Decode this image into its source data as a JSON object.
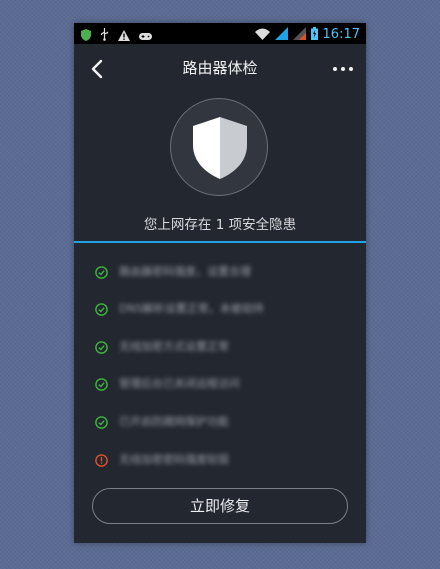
{
  "status_bar": {
    "time": "16:17",
    "icons": [
      "shield-app-icon",
      "usb-icon",
      "warning-icon",
      "game-controller-icon",
      "wifi-icon",
      "signal-icon",
      "signal-roaming-icon",
      "battery-icon"
    ]
  },
  "header": {
    "title": "路由器体检",
    "back_icon": "chevron-left-icon",
    "menu_icon": "more-horizontal-icon"
  },
  "summary": {
    "text": "您上网存在 1 项安全隐患"
  },
  "check_items": [
    {
      "status": "ok",
      "text": "路由器密码强度，设置合理"
    },
    {
      "status": "ok",
      "text": "DNS解析设置正常，未被劫持"
    },
    {
      "status": "ok",
      "text": "无线加密方式设置正常"
    },
    {
      "status": "ok",
      "text": "管理后台已关闭远程访问"
    },
    {
      "status": "ok",
      "text": "已开启防蹭网保护功能"
    },
    {
      "status": "warn",
      "text": "无线加密密码强度较弱"
    }
  ],
  "colors": {
    "accent": "#1fa3e6",
    "ok": "#3fb53f",
    "warn": "#e0522b",
    "background": "#23272f"
  },
  "action": {
    "label": "立即修复"
  }
}
